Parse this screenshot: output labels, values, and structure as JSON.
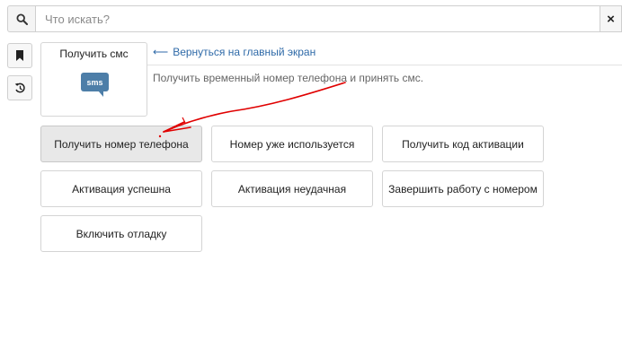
{
  "search": {
    "placeholder": "Что искать?",
    "clear_label": "×"
  },
  "sidebar": {
    "items": [
      {
        "icon": "bookmark-icon"
      },
      {
        "icon": "history-icon"
      }
    ]
  },
  "service": {
    "title": "Получить смс",
    "icon_text": "sms"
  },
  "back_link": {
    "label": "Вернуться на главный экран"
  },
  "description": "Получить временный номер телефона и принять смс.",
  "actions": [
    "Получить номер телефона",
    "Номер уже используется",
    "Получить код активации",
    "Активация успешна",
    "Активация неудачная",
    "Завершить работу с номером",
    "Включить отладку"
  ],
  "colors": {
    "link": "#2f6aa8",
    "sms_bubble": "#4d7ea8",
    "annotation": "#e00000"
  }
}
